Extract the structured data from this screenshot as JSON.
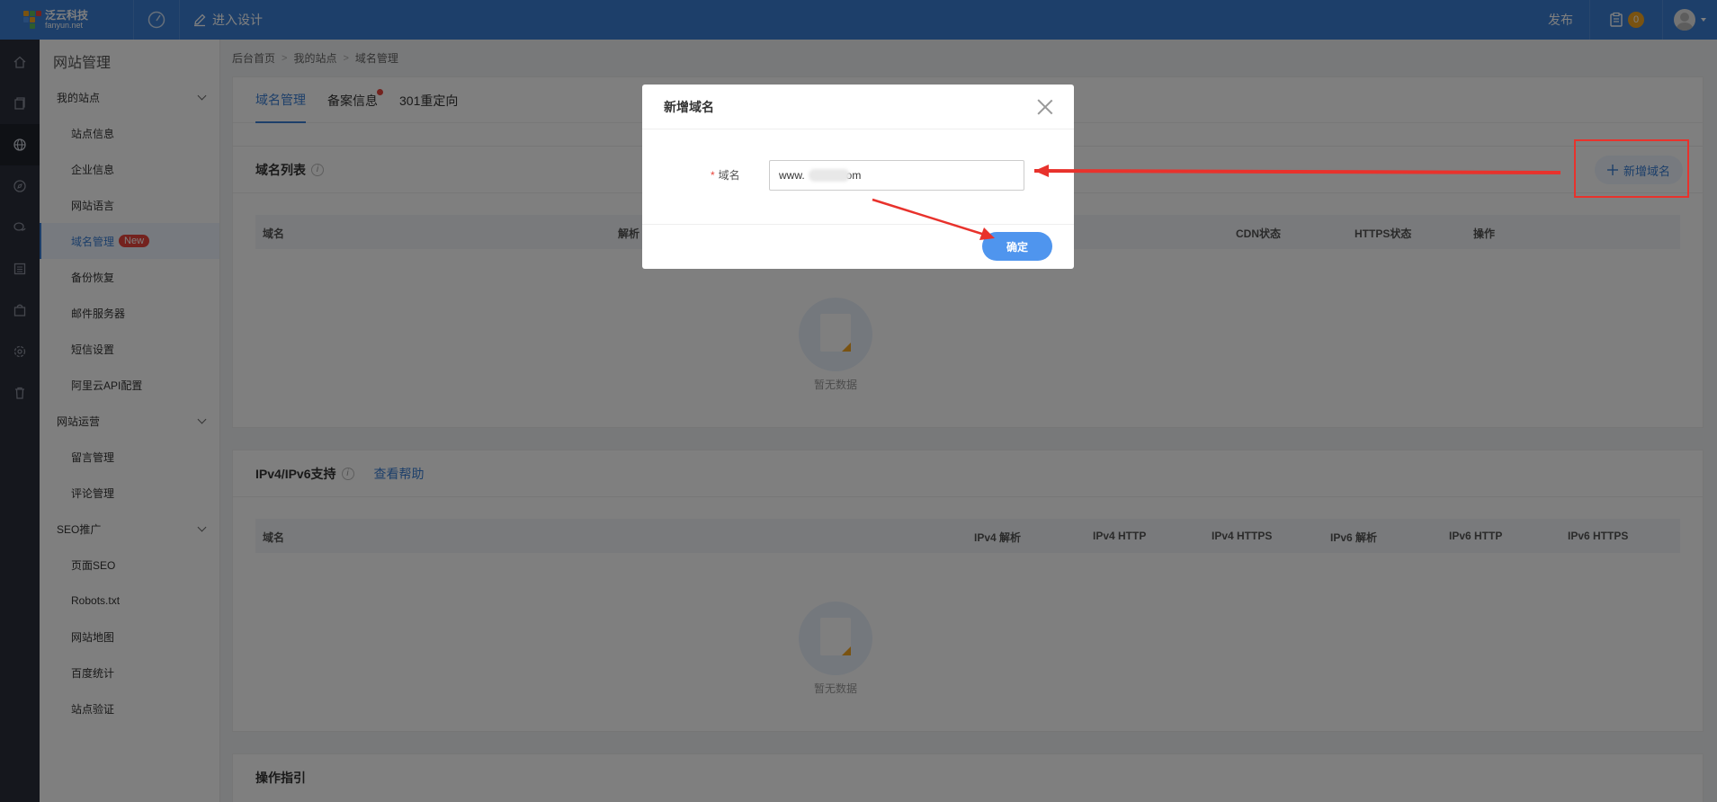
{
  "topbar": {
    "logo_cn": "泛云科技",
    "logo_en": "fanyun.net",
    "design_label": "进入设计",
    "publish_label": "发布",
    "notification_count": "0"
  },
  "sidebar": {
    "title": "网站管理",
    "groups": [
      {
        "label": "我的站点",
        "items": [
          "站点信息",
          "企业信息",
          "网站语言",
          "域名管理",
          "备份恢复",
          "邮件服务器",
          "短信设置",
          "阿里云API配置"
        ]
      },
      {
        "label": "网站运营",
        "items": [
          "留言管理",
          "评论管理"
        ]
      },
      {
        "label": "SEO推广",
        "items": [
          "页面SEO",
          "Robots.txt",
          "网站地图",
          "百度统计",
          "站点验证"
        ]
      }
    ],
    "active_item": "域名管理",
    "new_badge": "New"
  },
  "breadcrumb": [
    "后台首页",
    "我的站点",
    "域名管理"
  ],
  "tabs": [
    "域名管理",
    "备案信息",
    "301重定向"
  ],
  "domain_list": {
    "title": "域名列表",
    "add_button": "新增域名",
    "columns": [
      "域名",
      "解析",
      "CDN状态",
      "HTTPS状态",
      "操作"
    ],
    "empty_text": "暂无数据"
  },
  "ip_support": {
    "title": "IPv4/IPv6支持",
    "help_link": "查看帮助",
    "columns": [
      "域名",
      "IPv4 解析",
      "IPv4 HTTP",
      "IPv4 HTTPS",
      "IPv6 解析",
      "IPv6 HTTP",
      "IPv6 HTTPS"
    ],
    "empty_text": "暂无数据"
  },
  "guide": {
    "title": "操作指引"
  },
  "dialog": {
    "title": "新增域名",
    "field_label": "域名",
    "required_mark": "*",
    "field_value_prefix": "www.",
    "field_value_suffix": "om",
    "confirm_label": "确定"
  },
  "colors": {
    "topbar": "#3a7fd5",
    "accent": "#3a7fd5",
    "confirm": "#4f95ee",
    "annotation": "#e8322c",
    "badge_new": "#e8453c",
    "badge_notify": "#f5a623"
  },
  "icons": [
    "logo-icon",
    "speedometer-icon",
    "edit-icon",
    "clipboard-icon",
    "avatar-icon",
    "home-icon",
    "copy-icon",
    "globe-icon",
    "compass-icon",
    "chat-icon",
    "list-icon",
    "bag-icon",
    "settings-icon",
    "trash-icon",
    "info-icon",
    "plus-icon",
    "close-icon",
    "empty-state-icon"
  ]
}
